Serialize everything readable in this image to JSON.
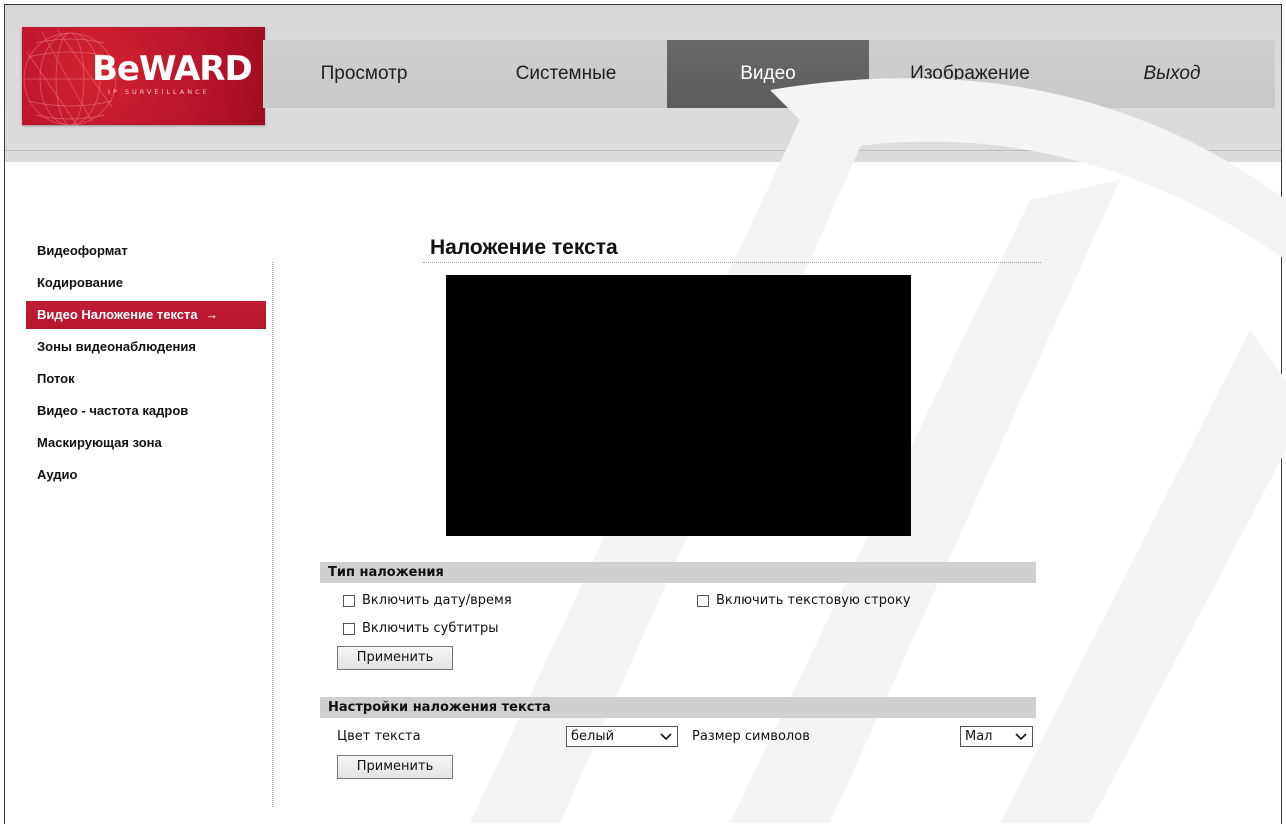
{
  "brand": {
    "logo_text": "BeWARD",
    "logo_subtext": "IP SURVEILLANCE",
    "primary_red": "#b8142b",
    "header_gray": "#d8d8d8",
    "active_tab_gray": "#5f5f5f"
  },
  "topnav": {
    "tabs": [
      {
        "label": "Просмотр",
        "active": false
      },
      {
        "label": "Системные",
        "active": false
      },
      {
        "label": "Видео",
        "active": true
      },
      {
        "label": "Изображение",
        "active": false
      },
      {
        "label": "Выход",
        "active": false
      }
    ]
  },
  "sidebar": {
    "items": [
      {
        "label": "Видеоформат",
        "active": false
      },
      {
        "label": "Кодирование",
        "active": false
      },
      {
        "label": "Видео Наложение текста",
        "active": true
      },
      {
        "label": "Зоны видеонаблюдения",
        "active": false
      },
      {
        "label": "Поток",
        "active": false
      },
      {
        "label": "Видео - частота кадров",
        "active": false
      },
      {
        "label": "Маскирующая зона",
        "active": false
      },
      {
        "label": "Аудио",
        "active": false
      }
    ],
    "active_arrow_icon": "arrow-right-icon",
    "active_arrow_glyph": "→"
  },
  "main": {
    "title": "Наложение текста",
    "overlay_type": {
      "header": "Тип наложения",
      "options": {
        "datetime": {
          "label": "Включить дату/время",
          "checked": false
        },
        "text_line": {
          "label": "Включить текстовую строку",
          "checked": false
        },
        "subtitles": {
          "label": "Включить субтитры",
          "checked": false
        }
      },
      "apply_label": "Применить"
    },
    "text_settings": {
      "header": "Настройки наложения текста",
      "color_label": "Цвет текста",
      "color_value": "белый",
      "size_label": "Размер символов",
      "size_value": "Мал",
      "apply_label": "Применить",
      "dropdown_icon": "chevron-down-icon",
      "dropdown_glyph": "❯"
    }
  }
}
